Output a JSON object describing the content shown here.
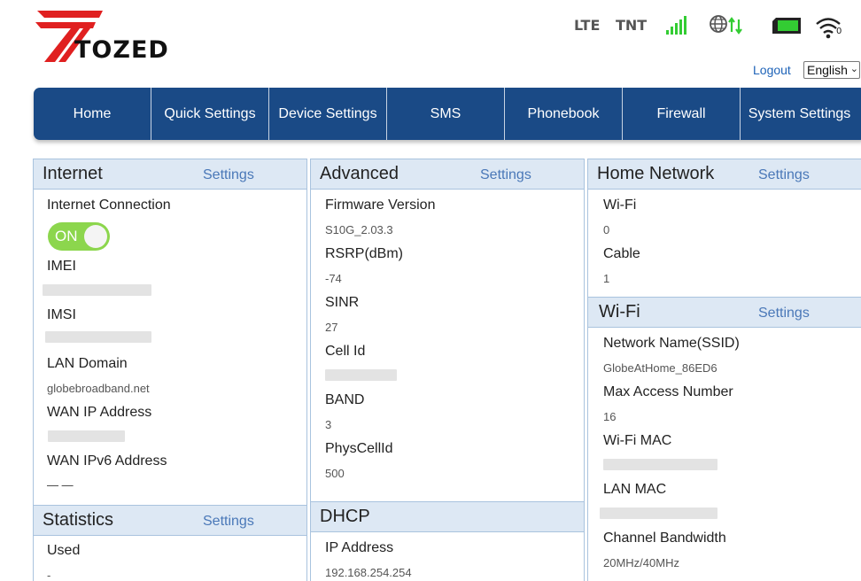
{
  "brand": {
    "name": "TOZED"
  },
  "status": {
    "network_type": "LTE",
    "operator": "TNT",
    "signal_icon": "signal-bars-icon",
    "data_icon": "globe-data-transfer-icon",
    "battery_icon": "battery-icon",
    "wifi_icon": "wifi-icon",
    "wifi_clients": "0",
    "accent_green": "#33cc33"
  },
  "header": {
    "logout": "Logout",
    "language": "English"
  },
  "nav": {
    "items": [
      {
        "label": "Home"
      },
      {
        "label": "Quick Settings"
      },
      {
        "label": "Device Settings"
      },
      {
        "label": "SMS"
      },
      {
        "label": "Phonebook"
      },
      {
        "label": "Firewall"
      },
      {
        "label": "System Settings"
      }
    ],
    "color": "#1a4a86"
  },
  "internet": {
    "title": "Internet",
    "settings": "Settings",
    "connection_label": "Internet Connection",
    "connection_toggle": "ON",
    "imei_label": "IMEI",
    "imsi_label": "IMSI",
    "lan_domain_label": "LAN Domain",
    "lan_domain_value": "globebroadband.net",
    "wan_ip_label": "WAN IP Address",
    "wan_ipv6_label": "WAN IPv6 Address",
    "wan_ipv6_value": "— —"
  },
  "statistics": {
    "title": "Statistics",
    "settings": "Settings",
    "used_label": "Used",
    "used_value": "-"
  },
  "advanced": {
    "title": "Advanced",
    "settings": "Settings",
    "firmware_label": "Firmware Version",
    "firmware_value": "S10G_2.03.3",
    "rsrp_label": "RSRP(dBm)",
    "rsrp_value": "-74",
    "sinr_label": "SINR",
    "sinr_value": "27",
    "cell_id_label": "Cell Id",
    "band_label": "BAND",
    "band_value": "3",
    "physcellid_label": "PhysCellId",
    "physcellid_value": "500"
  },
  "dhcp": {
    "title": "DHCP",
    "ip_label": "IP Address",
    "ip_value": "192.168.254.254"
  },
  "home_network": {
    "title": "Home Network",
    "settings": "Settings",
    "wifi_label": "Wi-Fi",
    "wifi_value": "0",
    "cable_label": "Cable",
    "cable_value": "1"
  },
  "wifi": {
    "title": "Wi-Fi",
    "settings": "Settings",
    "ssid_label": "Network Name(SSID)",
    "ssid_value": "GlobeAtHome_86ED6",
    "max_access_label": "Max Access Number",
    "max_access_value": "16",
    "wifi_mac_label": "Wi-Fi MAC",
    "lan_mac_label": "LAN MAC",
    "bandwidth_label": "Channel Bandwidth",
    "bandwidth_value": "20MHz/40MHz"
  }
}
